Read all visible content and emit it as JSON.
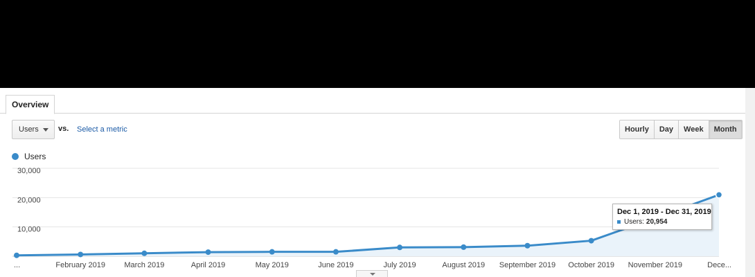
{
  "tabs": {
    "overview_label": "Overview"
  },
  "controls": {
    "metric_select_value": "Users",
    "vs_label": "vs.",
    "select_metric_link": "Select a metric",
    "period_buttons": [
      "Hourly",
      "Day",
      "Week",
      "Month"
    ],
    "active_period": "Month"
  },
  "legend": {
    "label": "Users",
    "color": "#3a8bc9"
  },
  "tooltip": {
    "title": "Dec 1, 2019 - Dec 31, 2019",
    "metric_label": "Users:",
    "metric_value": "20,954"
  },
  "chart_data": {
    "type": "area",
    "categories": [
      "...",
      "February 2019",
      "March 2019",
      "April 2019",
      "May 2019",
      "June 2019",
      "July 2019",
      "August 2019",
      "September 2019",
      "October 2019",
      "November 2019",
      "Dece..."
    ],
    "series": [
      {
        "name": "Users",
        "values": [
          300,
          600,
          1000,
          1400,
          1500,
          1500,
          3000,
          3100,
          3600,
          5300,
          13000,
          20954
        ],
        "color": "#3a8bc9"
      }
    ],
    "y_ticks": [
      "30,000",
      "20,000",
      "10,000"
    ],
    "ylim": [
      0,
      30000
    ],
    "grid": true,
    "highlighted_index": 11
  },
  "icons": {
    "select_caret": "caret-down-icon",
    "expander": "caret-down-icon",
    "legend": "dot-icon",
    "tooltip_swatch": "square-icon"
  }
}
